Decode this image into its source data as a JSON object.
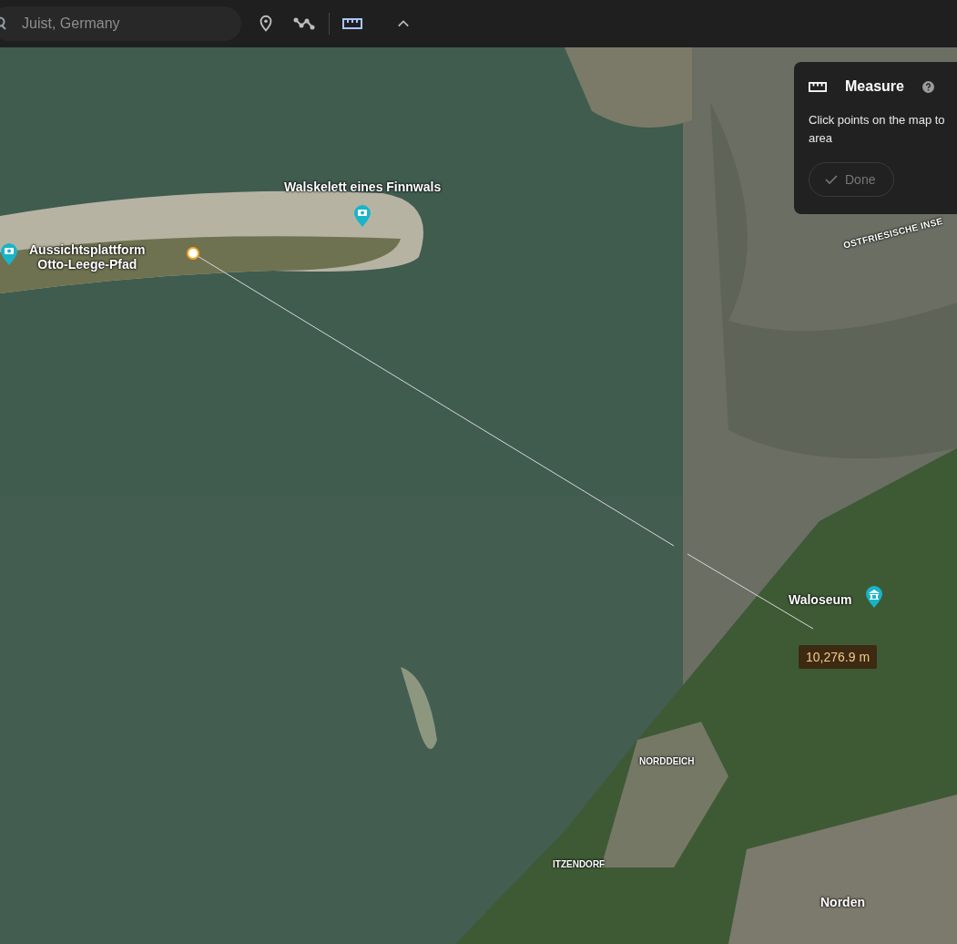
{
  "toolbar": {
    "search": {
      "value": "Juist, Germany"
    },
    "tools": [
      {
        "kind": "placemark",
        "selected": false
      },
      {
        "kind": "path",
        "selected": false
      },
      {
        "kind": "measure",
        "selected": true
      },
      {
        "kind": "collapse",
        "selected": false
      }
    ]
  },
  "map": {
    "places": [
      {
        "name": "Walskelett eines Finnwals",
        "kind": "photo"
      },
      {
        "name": "Aussichtsplattform\nOtto-Leege-Pfad",
        "kind": "photo"
      },
      {
        "name": "OSTFRIESISCHE INSE",
        "kind": "region"
      },
      {
        "name": "Waloseum",
        "kind": "museum"
      },
      {
        "name": "NORDDEICH",
        "kind": "town"
      },
      {
        "name": "ITZENDORF",
        "kind": "town"
      },
      {
        "name": "Norden",
        "kind": "city"
      }
    ],
    "measurement": {
      "distance": "10,276.9 m"
    }
  },
  "measure_panel": {
    "title": "Measure",
    "lines": [
      "Click points on the map to",
      "area"
    ],
    "done_button": {
      "label": "Done",
      "disabled": true
    }
  }
}
